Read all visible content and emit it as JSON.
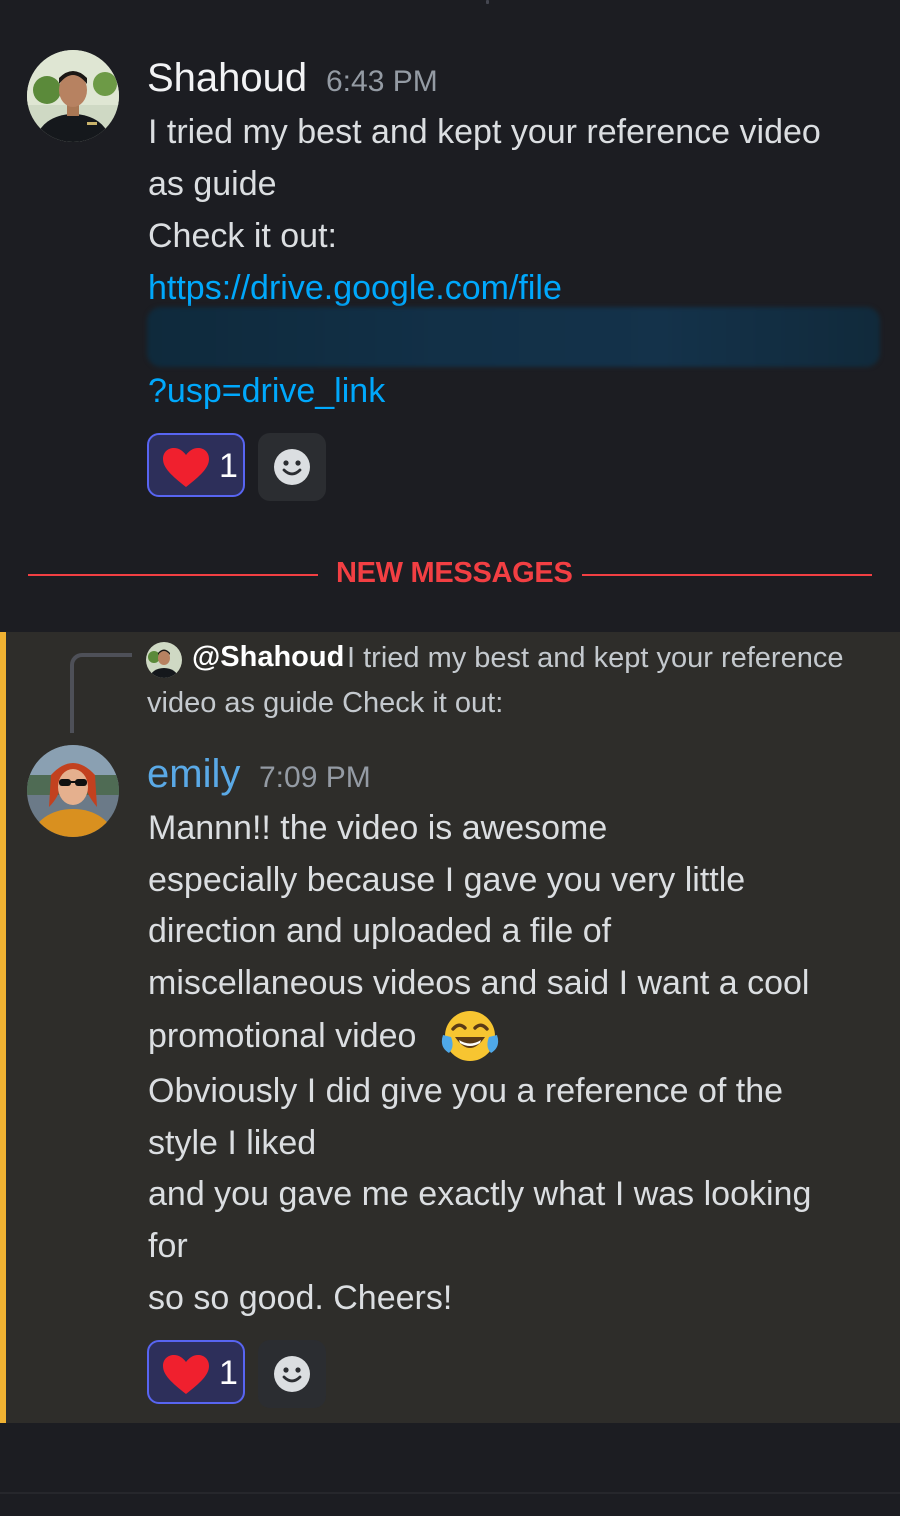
{
  "message1": {
    "author": "Shahoud",
    "timestamp": "6:43 PM",
    "lines": [
      "I tried my best and kept your reference video",
      "as guide",
      "Check it out:"
    ],
    "link_line1": "https://drive.google.com/file",
    "link_line3": "?usp=drive_link",
    "reaction": {
      "emoji": "heart",
      "count": "1"
    }
  },
  "divider": {
    "label": "NEW MESSAGES"
  },
  "message2": {
    "reply": {
      "author": "@Shahoud",
      "text_line1": "I tried my best and kept your reference",
      "text_line2": "video as guide Check it out:"
    },
    "author": "emily",
    "timestamp": "7:09 PM",
    "lines": [
      "Mannn!! the video is awesome",
      "especially because I gave you very little",
      "direction and uploaded a file of",
      "miscellaneous videos and said I want a cool",
      "promotional video",
      "Obviously I did give you a reference of the",
      "style I liked",
      "and you gave me exactly what I was looking",
      "for",
      "so so good. Cheers!"
    ],
    "reaction": {
      "emoji": "heart",
      "count": "1"
    }
  },
  "colors": {
    "background": "#1c1d22",
    "highlight": "#2e2d2a",
    "mention_bar": "#f0b232",
    "link": "#00a8fc",
    "new_messages": "#f23f43",
    "emily_name": "#5aa9e6",
    "reaction_border": "#5865f2"
  }
}
